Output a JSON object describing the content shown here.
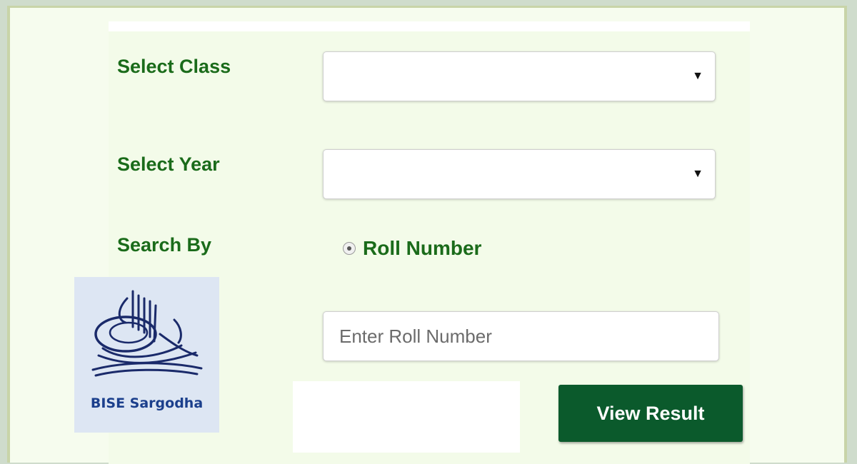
{
  "form": {
    "class_label": "Select Class",
    "class_value": "",
    "year_label": "Select Year",
    "year_value": "",
    "search_by_label": "Search By",
    "radio_label": "Roll Number",
    "roll_placeholder": "Enter Roll Number",
    "roll_value": "",
    "submit_label": "View Result"
  },
  "logo": {
    "text": "BISE Sargodha"
  },
  "colors": {
    "label_green": "#1a6b1a",
    "button_green": "#0b5a2c",
    "panel_bg": "#f3fbe9",
    "logo_blue": "#1b3f8c"
  },
  "icons": [
    "chevron-down-icon",
    "radio-selected-icon",
    "bise-emblem-icon"
  ]
}
